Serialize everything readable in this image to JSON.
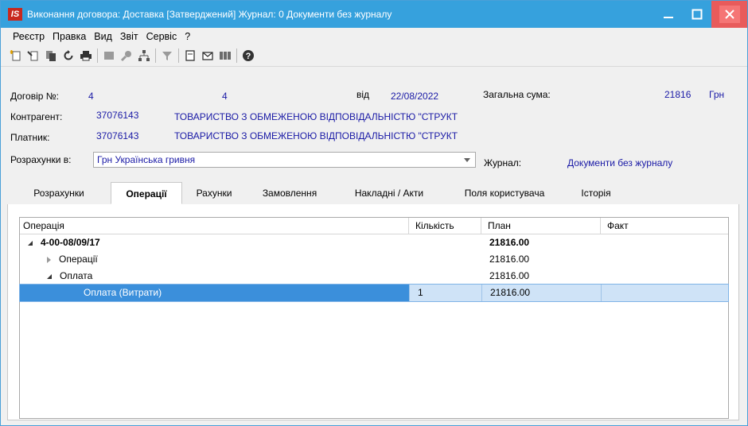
{
  "window": {
    "logo": "IS",
    "title": "Виконання договора: Доставка [Затверджений] Журнал: 0 Документи без журналу"
  },
  "menu": [
    "Реєстр",
    "Правка",
    "Вид",
    "Звіт",
    "Сервіс",
    "?"
  ],
  "toolbar": {
    "icons": [
      "new-doc-icon",
      "edit-doc-icon",
      "copy-doc-icon",
      "refresh-icon",
      "print-icon",
      "disabled-doc-icon",
      "key-icon",
      "tree-icon",
      "filter-icon",
      "form-icon",
      "mail-icon",
      "barcode-icon",
      "help-icon"
    ]
  },
  "header": {
    "contract_label": "Договір №:",
    "contract_number": "4",
    "contract_number2": "4",
    "from_label": "від",
    "date": "22/08/2022",
    "total_label": "Загальна сума:",
    "total_value": "21816",
    "total_currency": "Грн",
    "counterparty_label": "Контрагент:",
    "counterparty_code": "37076143",
    "counterparty_name": "ТОВАРИСТВО З ОБМЕЖЕНОЮ ВІДПОВІДАЛЬНІСТЮ \"СТРУКТ",
    "payer_label": "Платник:",
    "payer_code": "37076143",
    "payer_name": "ТОВАРИСТВО З ОБМЕЖЕНОЮ ВІДПОВІДАЛЬНІСТЮ \"СТРУКТ",
    "settlement_label": "Розрахунки в:",
    "settlement_value": "Грн Українська гривня",
    "journal_label": "Журнал:",
    "journal_value": "Документи без журналу"
  },
  "tabs": [
    {
      "label": "Розрахунки"
    },
    {
      "label": "Операції",
      "active": true
    },
    {
      "label": "Рахунки"
    },
    {
      "label": "Замовлення"
    },
    {
      "label": "Накладні / Акти"
    },
    {
      "label": "Поля користувача"
    },
    {
      "label": "Історія"
    }
  ],
  "grid": {
    "columns": [
      "Операція",
      "Кількість",
      "План",
      "Факт"
    ],
    "rows": [
      {
        "name": "4-00-08/09/17",
        "qty": "",
        "plan": "21816.00",
        "fact": ""
      },
      {
        "name": "Операції",
        "qty": "",
        "plan": "21816.00",
        "fact": ""
      },
      {
        "name": "Оплата",
        "qty": "",
        "plan": "21816.00",
        "fact": ""
      },
      {
        "name": "Оплата (Витрати)",
        "qty": "1",
        "plan": "21816.00",
        "fact": ""
      }
    ]
  },
  "colors": {
    "titlebar": "#36a1dd",
    "close_button": "#e85b5b",
    "value_text": "#1a1aa6",
    "selection": "#3b8fdb"
  }
}
